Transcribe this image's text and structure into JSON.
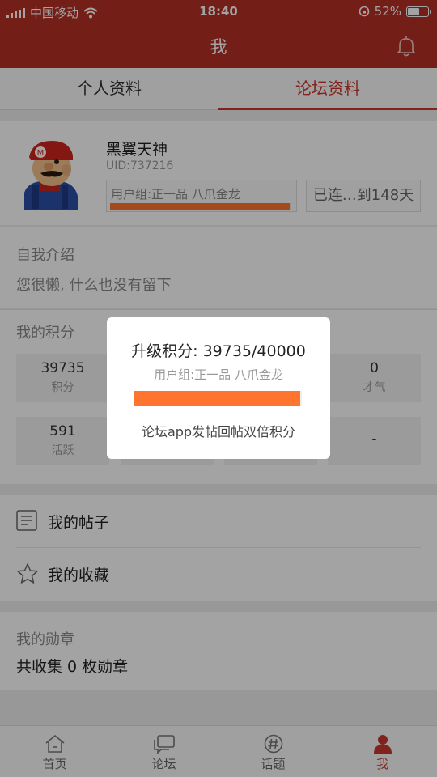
{
  "status_bar": {
    "carrier": "中国移动",
    "time": "18:40",
    "battery": "52%",
    "battery_level": 0.52
  },
  "header": {
    "title": "我"
  },
  "tabs": [
    {
      "label": "个人资料",
      "active": false
    },
    {
      "label": "论坛资料",
      "active": true
    }
  ],
  "profile": {
    "username": "黑翼天神",
    "uid": "UID:737216",
    "group": "用户组:正一品  八爪金龙",
    "group_progress": 0.99,
    "signin": "已连…到148天"
  },
  "intro": {
    "label": "自我介绍",
    "text": "您很懒, 什么也没有留下"
  },
  "points": {
    "label": "我的积分",
    "items": [
      {
        "value": "39735",
        "name": "积分"
      },
      {
        "value": "",
        "name": ""
      },
      {
        "value": "",
        "name": ""
      },
      {
        "value": "0",
        "name": "才气"
      },
      {
        "value": "591",
        "name": "活跃"
      },
      {
        "value": "",
        "name": ""
      },
      {
        "value": "",
        "name": ""
      },
      {
        "value": "-",
        "name": ""
      }
    ]
  },
  "menu": {
    "posts": "我的帖子",
    "favorites": "我的收藏"
  },
  "medals": {
    "label": "我的勋章",
    "count": "共收集 0 枚勋章"
  },
  "bottom_nav": [
    {
      "label": "首页",
      "icon": "home-icon",
      "active": false
    },
    {
      "label": "论坛",
      "icon": "forum-icon",
      "active": false
    },
    {
      "label": "话题",
      "icon": "topic-icon",
      "active": false
    },
    {
      "label": "我",
      "icon": "profile-icon",
      "active": true
    }
  ],
  "modal": {
    "title": "升级积分: 39735/40000",
    "group": "用户组:正一品  八爪金龙",
    "progress": 0.99,
    "note": "论坛app发帖回帖双倍积分"
  },
  "colors": {
    "brand": "#b43126",
    "accent": "#c8372d",
    "progress": "#ff7530"
  }
}
